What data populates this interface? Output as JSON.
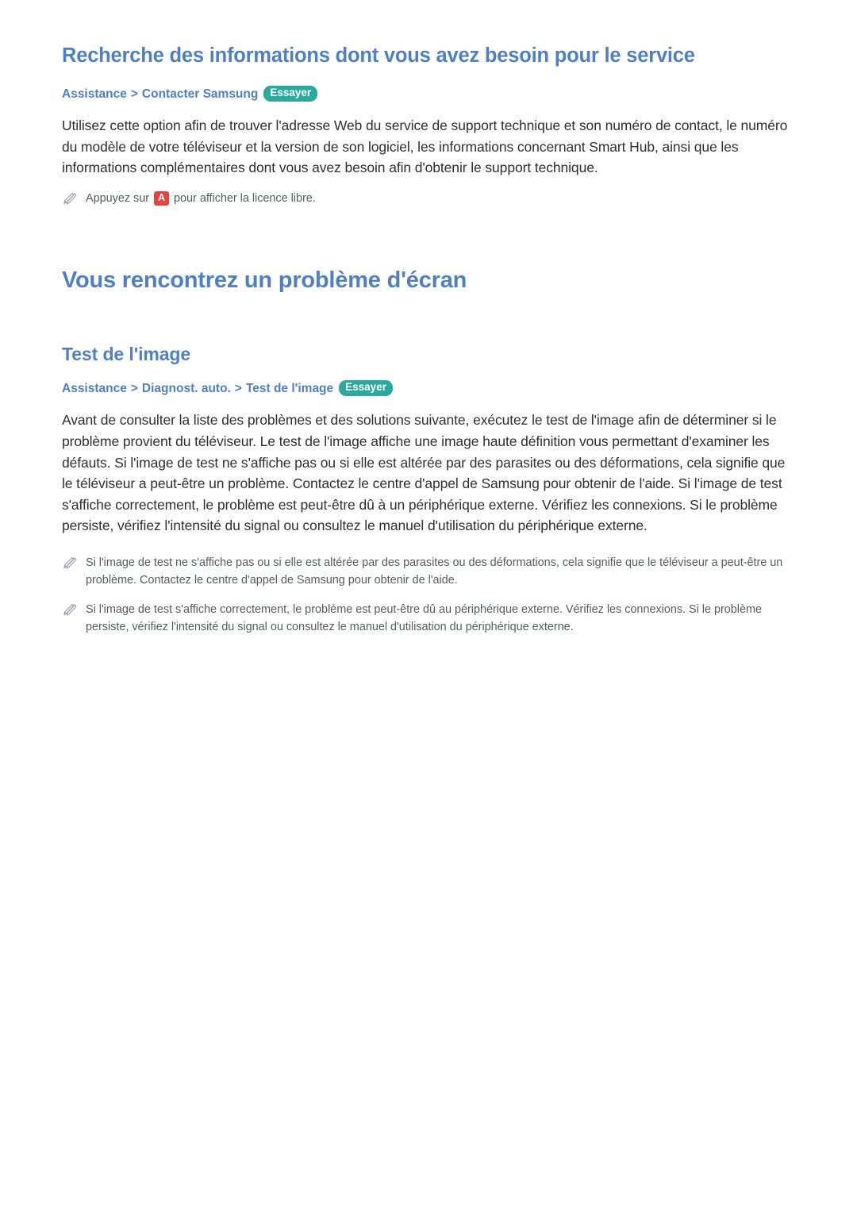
{
  "sections": [
    {
      "title": "Recherche des informations dont vous avez besoin pour le service",
      "breadcrumb": {
        "parts": [
          "Assistance",
          "Contacter Samsung"
        ],
        "badge": "Essayer"
      },
      "paragraph": "Utilisez cette option afin de trouver l'adresse Web du service de support technique et son numéro de contact, le numéro du modèle de votre téléviseur et la version de son logiciel, les informations concernant Smart Hub, ainsi que les informations complémentaires dont vous avez besoin afin d'obtenir le support technique.",
      "note": {
        "prefix": "Appuyez sur",
        "key": "A",
        "suffix": "pour afficher la licence libre."
      }
    },
    {
      "heading": "Vous rencontrez un problème d'écran",
      "subtitle": "Test de l'image",
      "breadcrumb": {
        "parts": [
          "Assistance",
          "Diagnost. auto.",
          "Test de l'image"
        ],
        "badge": "Essayer"
      },
      "paragraph": "Avant de consulter la liste des problèmes et des solutions suivante, exécutez le test de l'image afin de déterminer si le problème provient du téléviseur. Le test de l'image affiche une image haute définition vous permettant d'examiner les défauts. Si l'image de test ne s'affiche pas ou si elle est altérée par des parasites ou des déformations, cela signifie que le téléviseur a peut-être un problème. Contactez le centre d'appel de Samsung pour obtenir de l'aide. Si l'image de test s'affiche correctement, le problème est peut-être dû à un périphérique externe. Vérifiez les connexions. Si le problème persiste, vérifiez l'intensité du signal ou consultez le manuel d'utilisation du périphérique externe.",
      "notes": [
        "Si l'image de test ne s'affiche pas ou si elle est altérée par des parasites ou des déformations, cela signifie que le téléviseur a peut-être un problème. Contactez le centre d'appel de Samsung pour obtenir de l'aide.",
        "Si l'image de test s'affiche correctement, le problème est peut-être dû au périphérique externe. Vérifiez les connexions. Si le problème persiste, vérifiez l'intensité du signal ou consultez le manuel d'utilisation du périphérique externe."
      ]
    }
  ],
  "icons": {
    "note": "pencil-icon"
  },
  "colors": {
    "accent": "#4f7fc4",
    "badge": "#2aaa9e",
    "key": "#e8403a",
    "text": "#2f2f2f",
    "note_text": "#555c63"
  }
}
